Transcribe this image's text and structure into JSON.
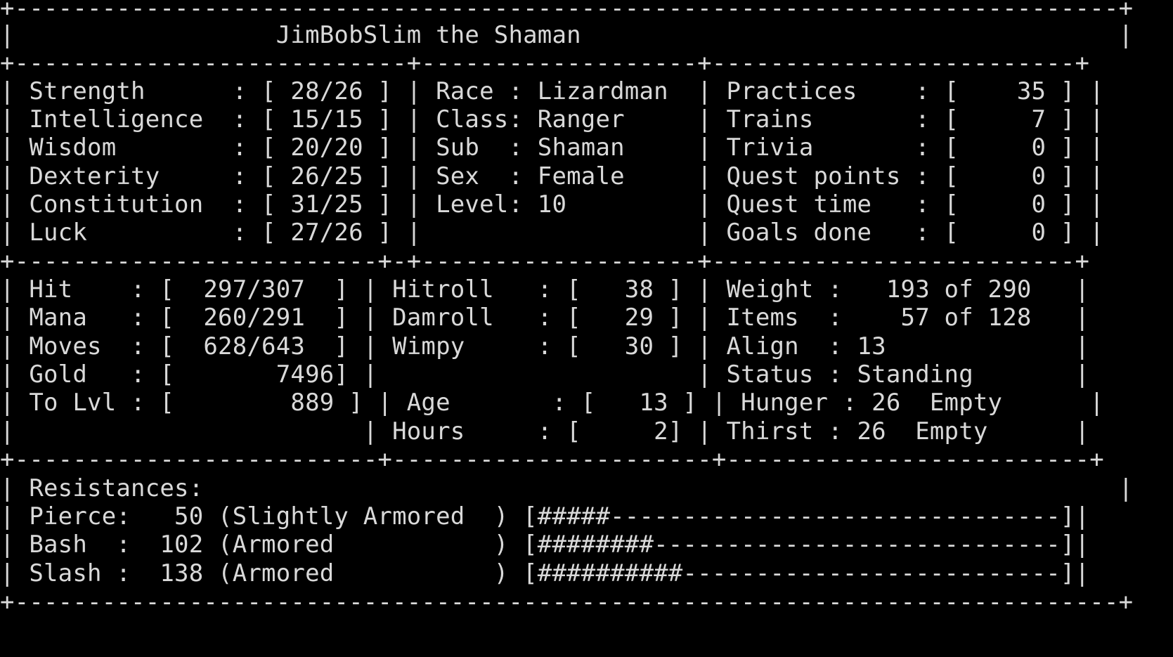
{
  "colors": {
    "background": "#000000",
    "text": "#d9d9d9"
  },
  "terminal": {
    "lines": [
      {
        "name": "border-top",
        "text": "+----------------------------------------------------------------------------+"
      },
      {
        "name": "character-title",
        "text": "|                  JimBobSlim the Shaman                                     |"
      },
      {
        "name": "border-stats-top",
        "text": "+---------------------------+-------------------+-------------------------+"
      },
      {
        "name": "row-strength-race-practices",
        "text": "| Strength      : [ 28/26 ] | Race : Lizardman  | Practices    : [    35 ] |"
      },
      {
        "name": "row-intelligence-class-trains",
        "text": "| Intelligence  : [ 15/15 ] | Class: Ranger     | Trains       : [     7 ] |"
      },
      {
        "name": "row-wisdom-sub-trivia",
        "text": "| Wisdom        : [ 20/20 ] | Sub  : Shaman     | Trivia       : [     0 ] |"
      },
      {
        "name": "row-dexterity-sex-questpoints",
        "text": "| Dexterity     : [ 26/25 ] | Sex  : Female     | Quest points : [     0 ] |"
      },
      {
        "name": "row-constitution-level-questtime",
        "text": "| Constitution  : [ 31/25 ] | Level: 10         | Quest time   : [     0 ] |"
      },
      {
        "name": "row-luck-goalsdone",
        "text": "| Luck          : [ 27/26 ] |                   | Goals done   : [     0 ] |"
      },
      {
        "name": "border-vitals-top",
        "text": "+-------------------------+-+-------------------+-------------------------+"
      },
      {
        "name": "row-hit-hitroll-weight",
        "text": "| Hit    : [  297/307  ] | Hitroll   : [   38 ] | Weight :   193 of 290   |"
      },
      {
        "name": "row-mana-damroll-items",
        "text": "| Mana   : [  260/291  ] | Damroll   : [   29 ] | Items  :    57 of 128   |"
      },
      {
        "name": "row-moves-wimpy-align",
        "text": "| Moves  : [  628/643  ] | Wimpy     : [   30 ] | Align  : 13             |"
      },
      {
        "name": "row-gold-status",
        "text": "| Gold   : [       7496] |                      | Status : Standing       |"
      },
      {
        "name": "row-tolvl-age-hunger",
        "text": "| To Lvl : [        889 ] | Age       : [   13 ] | Hunger : 26  Empty      |"
      },
      {
        "name": "row-hours-thirst",
        "text": "|                        | Hours     : [     2] | Thirst : 26  Empty      |"
      },
      {
        "name": "border-resist-top",
        "text": "+-------------------------+----------------------+-------------------------+"
      },
      {
        "name": "row-resistances-label",
        "text": "| Resistances:                                                               |"
      },
      {
        "name": "row-pierce",
        "text": "| Pierce:   50 (Slightly Armored  ) [#####-------------------------------]|"
      },
      {
        "name": "row-bash",
        "text": "| Bash  :  102 (Armored           ) [########----------------------------]|"
      },
      {
        "name": "row-slash",
        "text": "| Slash :  138 (Armored           ) [##########--------------------------]|"
      },
      {
        "name": "border-bottom",
        "text": "+----------------------------------------------------------------------------+"
      }
    ]
  }
}
